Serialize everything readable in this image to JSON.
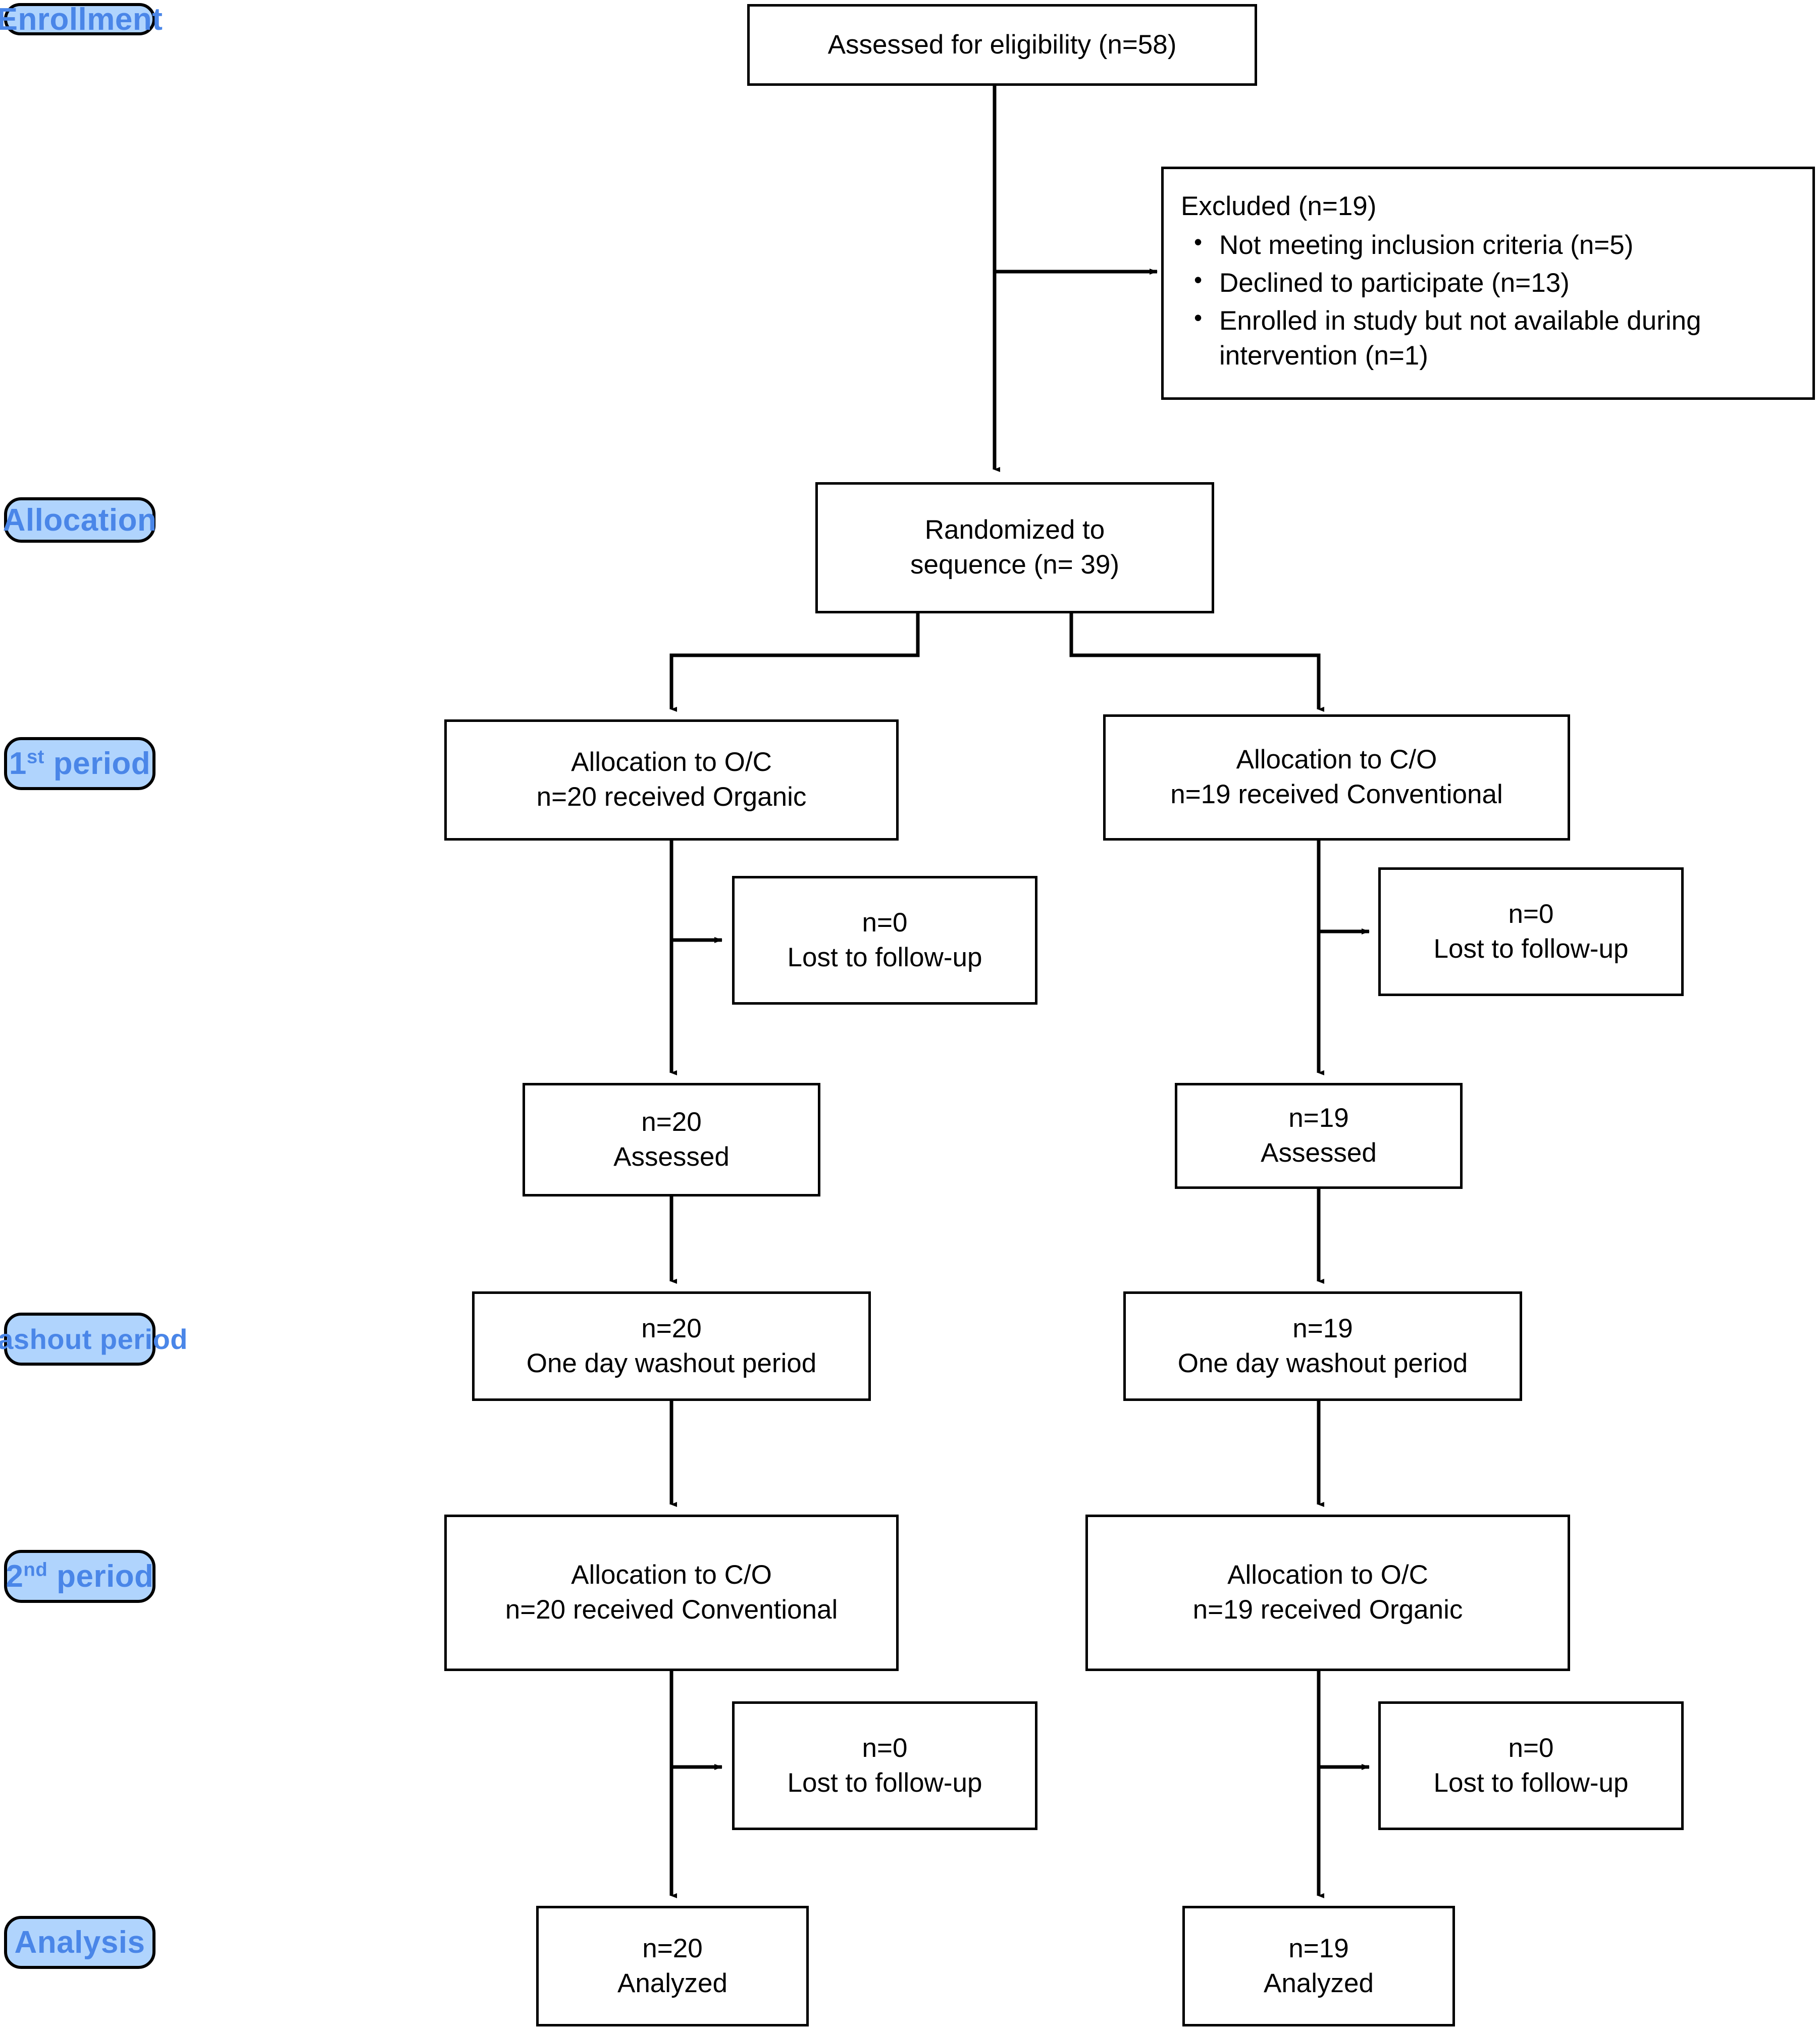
{
  "theme": {
    "label_fill": "#b0d4fd",
    "label_text": "#4a86e8",
    "node_border": "#000000",
    "node_fill": "#ffffff",
    "line_color": "#000000"
  },
  "stage_labels": {
    "enrollment": "Enrollment",
    "allocation": "Allocation",
    "period1_num": "1",
    "period1_sup": "st",
    "period1_rest": " period",
    "washout": "Washout period",
    "period2_num": "2",
    "period2_sup": "nd",
    "period2_rest": " period",
    "analysis": "Analysis"
  },
  "nodes": {
    "assessed": "Assessed for eligibility (n=58)",
    "excluded": {
      "title": "Excluded (n=19)",
      "items": [
        "Not meeting inclusion criteria (n=5)",
        "Declined to participate (n=13)",
        "Enrolled in study but not available during intervention (n=1)"
      ]
    },
    "randomized": {
      "line1": "Randomized to",
      "line2": "sequence (n= 39)"
    },
    "alloc_left_p1": {
      "line1": "Allocation to O/C",
      "line2": "n=20 received Organic"
    },
    "alloc_right_p1": {
      "line1": "Allocation to C/O",
      "line2": "n=19 received Conventional"
    },
    "lost_left_p1": {
      "line1": "n=0",
      "line2": "Lost to follow-up"
    },
    "lost_right_p1": {
      "line1": "n=0",
      "line2": "Lost to follow-up"
    },
    "assessed_left": {
      "line1": "n=20",
      "line2": "Assessed"
    },
    "assessed_right": {
      "line1": "n=19",
      "line2": "Assessed"
    },
    "washout_left": {
      "line1": "n=20",
      "line2": "One day washout period"
    },
    "washout_right": {
      "line1": "n=19",
      "line2": "One day washout period"
    },
    "alloc_left_p2": {
      "line1": "Allocation to C/O",
      "line2": "n=20 received Conventional"
    },
    "alloc_right_p2": {
      "line1": "Allocation to O/C",
      "line2": "n=19 received Organic"
    },
    "lost_left_p2": {
      "line1": "n=0",
      "line2": "Lost to follow-up"
    },
    "lost_right_p2": {
      "line1": "n=0",
      "line2": "Lost to follow-up"
    },
    "analyzed_left": {
      "line1": "n=20",
      "line2": "Analyzed"
    },
    "analyzed_right": {
      "line1": "n=19",
      "line2": "Analyzed"
    }
  }
}
